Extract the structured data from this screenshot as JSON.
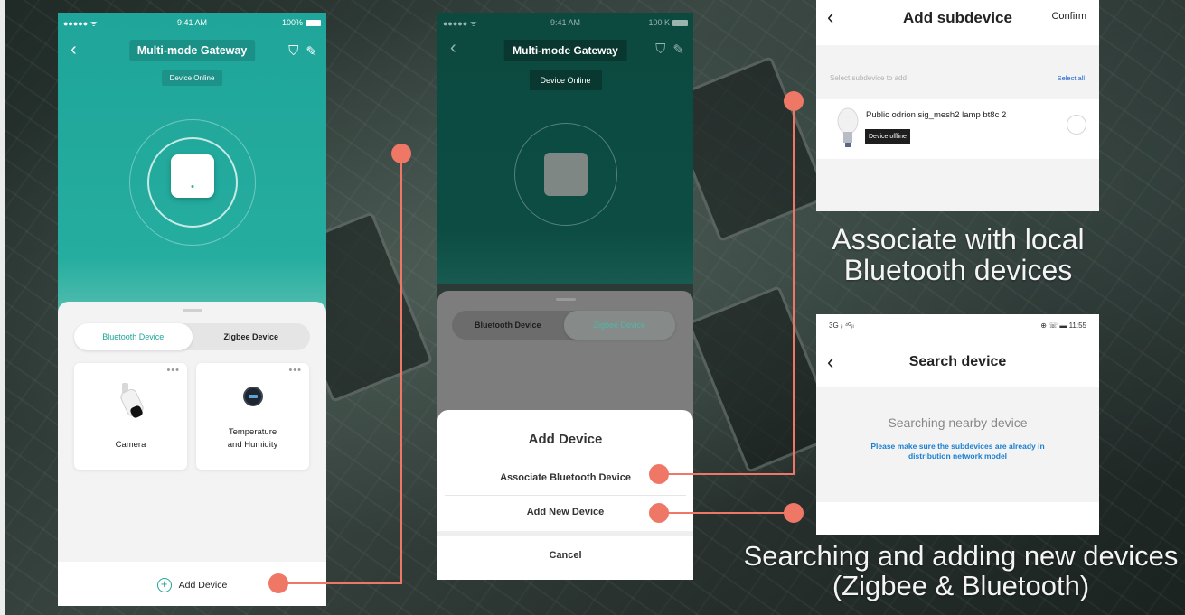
{
  "phone1": {
    "status": {
      "carrier": "●●●●● ᯤ",
      "time": "9:41 AM",
      "battery": "100%"
    },
    "title": "Multi-mode Gateway",
    "subtitle": "Device Online",
    "tabs": [
      "Bluetooth Device",
      "Zigbee Device"
    ],
    "cards": [
      {
        "label": "Camera",
        "icon": "camera-icon"
      },
      {
        "label": "Temperature\nand Humidity",
        "icon": "thermometer-icon"
      }
    ],
    "add_device": "Add Device"
  },
  "phone2": {
    "status": {
      "carrier": "●●●●● ᯤ",
      "time": "9:41 AM",
      "battery": "100 K"
    },
    "title": "Multi-mode Gateway",
    "subtitle": "Device Online",
    "tabs": [
      "Bluetooth Device",
      "Zigbee Device"
    ],
    "dialog": {
      "title": "Add Device",
      "items": [
        "Associate Bluetooth Device",
        "Add New Device"
      ],
      "cancel": "Cancel"
    }
  },
  "panel_add_subdevice": {
    "title": "Add subdevice",
    "confirm": "Confirm",
    "hint": "Select subdevice to add",
    "select_all": "Select all",
    "device_name": "Public odrion sig_mesh2 lamp bt8c 2",
    "device_status": "Device offline"
  },
  "panel_search": {
    "status_left": "3G ᵢₗ ⁴ᴳᵢₗ",
    "status_right": "⊕ ☏ ▬ 11:55",
    "title": "Search device",
    "searching": "Searching nearby device",
    "note": "Please make sure the subdevices are already in distribution network model"
  },
  "captions": {
    "associate": "Associate with local\nBluetooth devices",
    "searching": "Searching and adding new devices\n(Zigbee & Bluetooth)"
  },
  "colors": {
    "teal": "#1fa59a",
    "dark_teal": "#0c4a40",
    "connector": "#ee7766",
    "link_blue": "#1a5fcc"
  }
}
